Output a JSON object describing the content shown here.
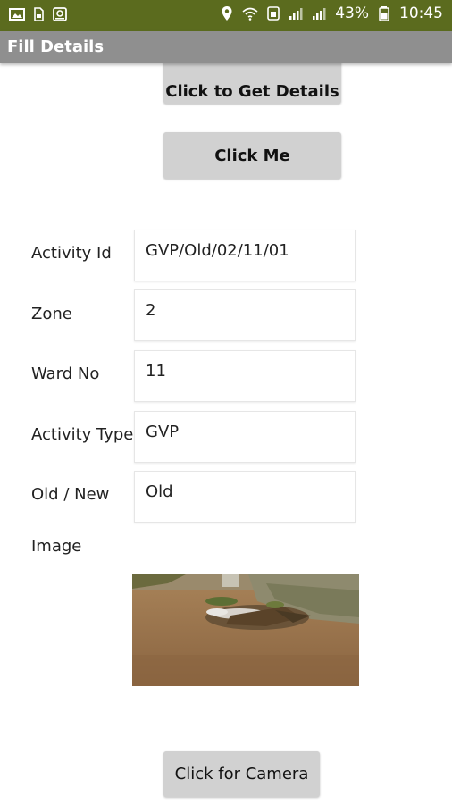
{
  "status_bar": {
    "battery": "43%",
    "time": "10:45",
    "icons": [
      "image-icon",
      "sim-icon",
      "screenshot-icon",
      "location-icon",
      "wifi-icon",
      "data-icon",
      "signal-icon",
      "signal-icon",
      "battery-icon"
    ],
    "background": "#5b6b1e"
  },
  "app_bar": {
    "title": "Fill Details",
    "background": "#8f8f8f"
  },
  "buttons": {
    "get_details": "Click to Get Details",
    "click_me": "Click Me",
    "camera": "Click for Camera"
  },
  "form": {
    "activity_id": {
      "label": "Activity Id",
      "value": "GVP/Old/02/11/01"
    },
    "zone": {
      "label": "Zone",
      "value": "2"
    },
    "ward_no": {
      "label": "Ward No",
      "value": "11"
    },
    "activity_type": {
      "label": "Activity Type",
      "value": "GVP"
    },
    "old_new": {
      "label": "Old / New",
      "value": "Old"
    },
    "image": {
      "label": "Image"
    }
  }
}
